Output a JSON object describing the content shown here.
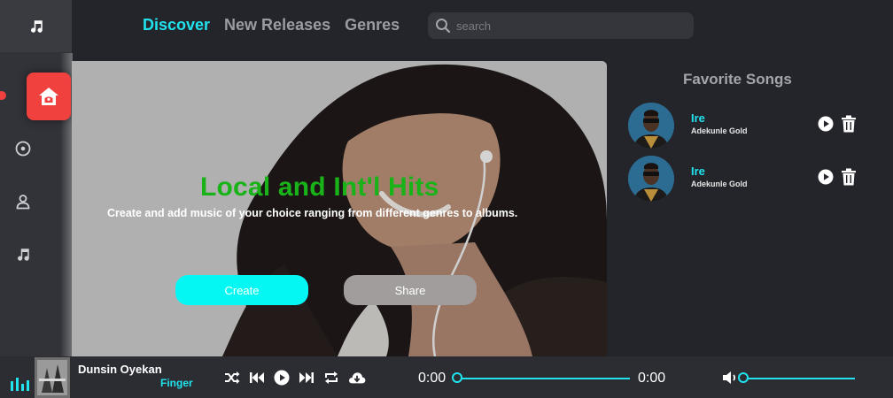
{
  "nav": {
    "discover": "Discover",
    "new_releases": "New Releases",
    "genres": "Genres"
  },
  "search": {
    "placeholder": "search"
  },
  "hero": {
    "title": "Local and Int'l Hits",
    "subtitle": "Create and add music of your choice ranging from different genres to albums.",
    "create_label": "Create",
    "share_label": "Share"
  },
  "favorites": {
    "title": "Favorite Songs",
    "items": [
      {
        "name": "Ire",
        "artist": "Adekunle Gold"
      },
      {
        "name": "Ire",
        "artist": "Adekunle Gold"
      }
    ]
  },
  "player": {
    "artist": "Dunsin Oyekan",
    "song": "Finger",
    "current_time": "0:00",
    "duration": "0:00",
    "progress": 0,
    "volume": 0
  },
  "colors": {
    "accent": "#20e3ee",
    "active": "#f0413e",
    "hero_title": "#19b319",
    "create_button": "#03f8f4",
    "share_button": "#a19d9d"
  },
  "icons": {
    "logo": "music-note-icon",
    "sidebar": [
      "home-icon",
      "disc-icon",
      "user-icon",
      "music-note-icon"
    ],
    "controls": [
      "shuffle-icon",
      "previous-icon",
      "play-icon",
      "next-icon",
      "repeat-icon",
      "cloud-download-icon"
    ]
  }
}
